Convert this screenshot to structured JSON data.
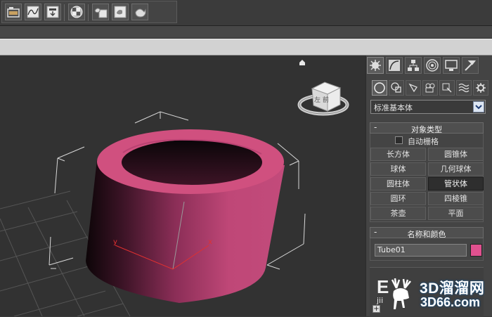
{
  "toolbar": {
    "buttons": [
      {
        "name": "layer-manager-icon"
      },
      {
        "name": "curve-editor-icon"
      },
      {
        "name": "schematic-view-icon"
      },
      {
        "name": "material-editor-icon"
      },
      {
        "name": "render-setup-icon"
      },
      {
        "name": "rendered-frame-icon"
      },
      {
        "name": "render-teapot-icon"
      }
    ]
  },
  "viewport": {
    "object_color": "#d0507f",
    "grid_color": "#5a5a5a",
    "axis_x_label": "x",
    "axis_y_label": "y",
    "viewcube_label": "左 前"
  },
  "command_panel": {
    "tabs": [
      "create-icon",
      "modify-icon",
      "hierarchy-icon",
      "motion-icon",
      "display-icon",
      "utilities-icon"
    ],
    "category_icons": [
      "geometry-icon",
      "shapes-icon",
      "lights-icon",
      "cameras-icon",
      "helpers-icon",
      "spacewarps-icon",
      "systems-icon"
    ],
    "dropdown_value": "标准基本体",
    "object_type": {
      "title": "对象类型",
      "autogrid_label": "自动栅格",
      "autogrid_checked": false,
      "buttons": [
        "长方体",
        "圆锥体",
        "球体",
        "几何球体",
        "圆柱体",
        "管状体",
        "圆环",
        "四棱锥",
        "茶壶",
        "平面"
      ],
      "selected": "管状体"
    },
    "name_color": {
      "title": "名称和颜色",
      "name_value": "Tube01",
      "color": "#e0518f"
    },
    "collapse_symbol": "-",
    "stub_letter": "E",
    "stub_text": "jii",
    "stub_plus": "+"
  },
  "watermark": {
    "title": "3D溜溜网",
    "subtitle": "3D66.com"
  }
}
